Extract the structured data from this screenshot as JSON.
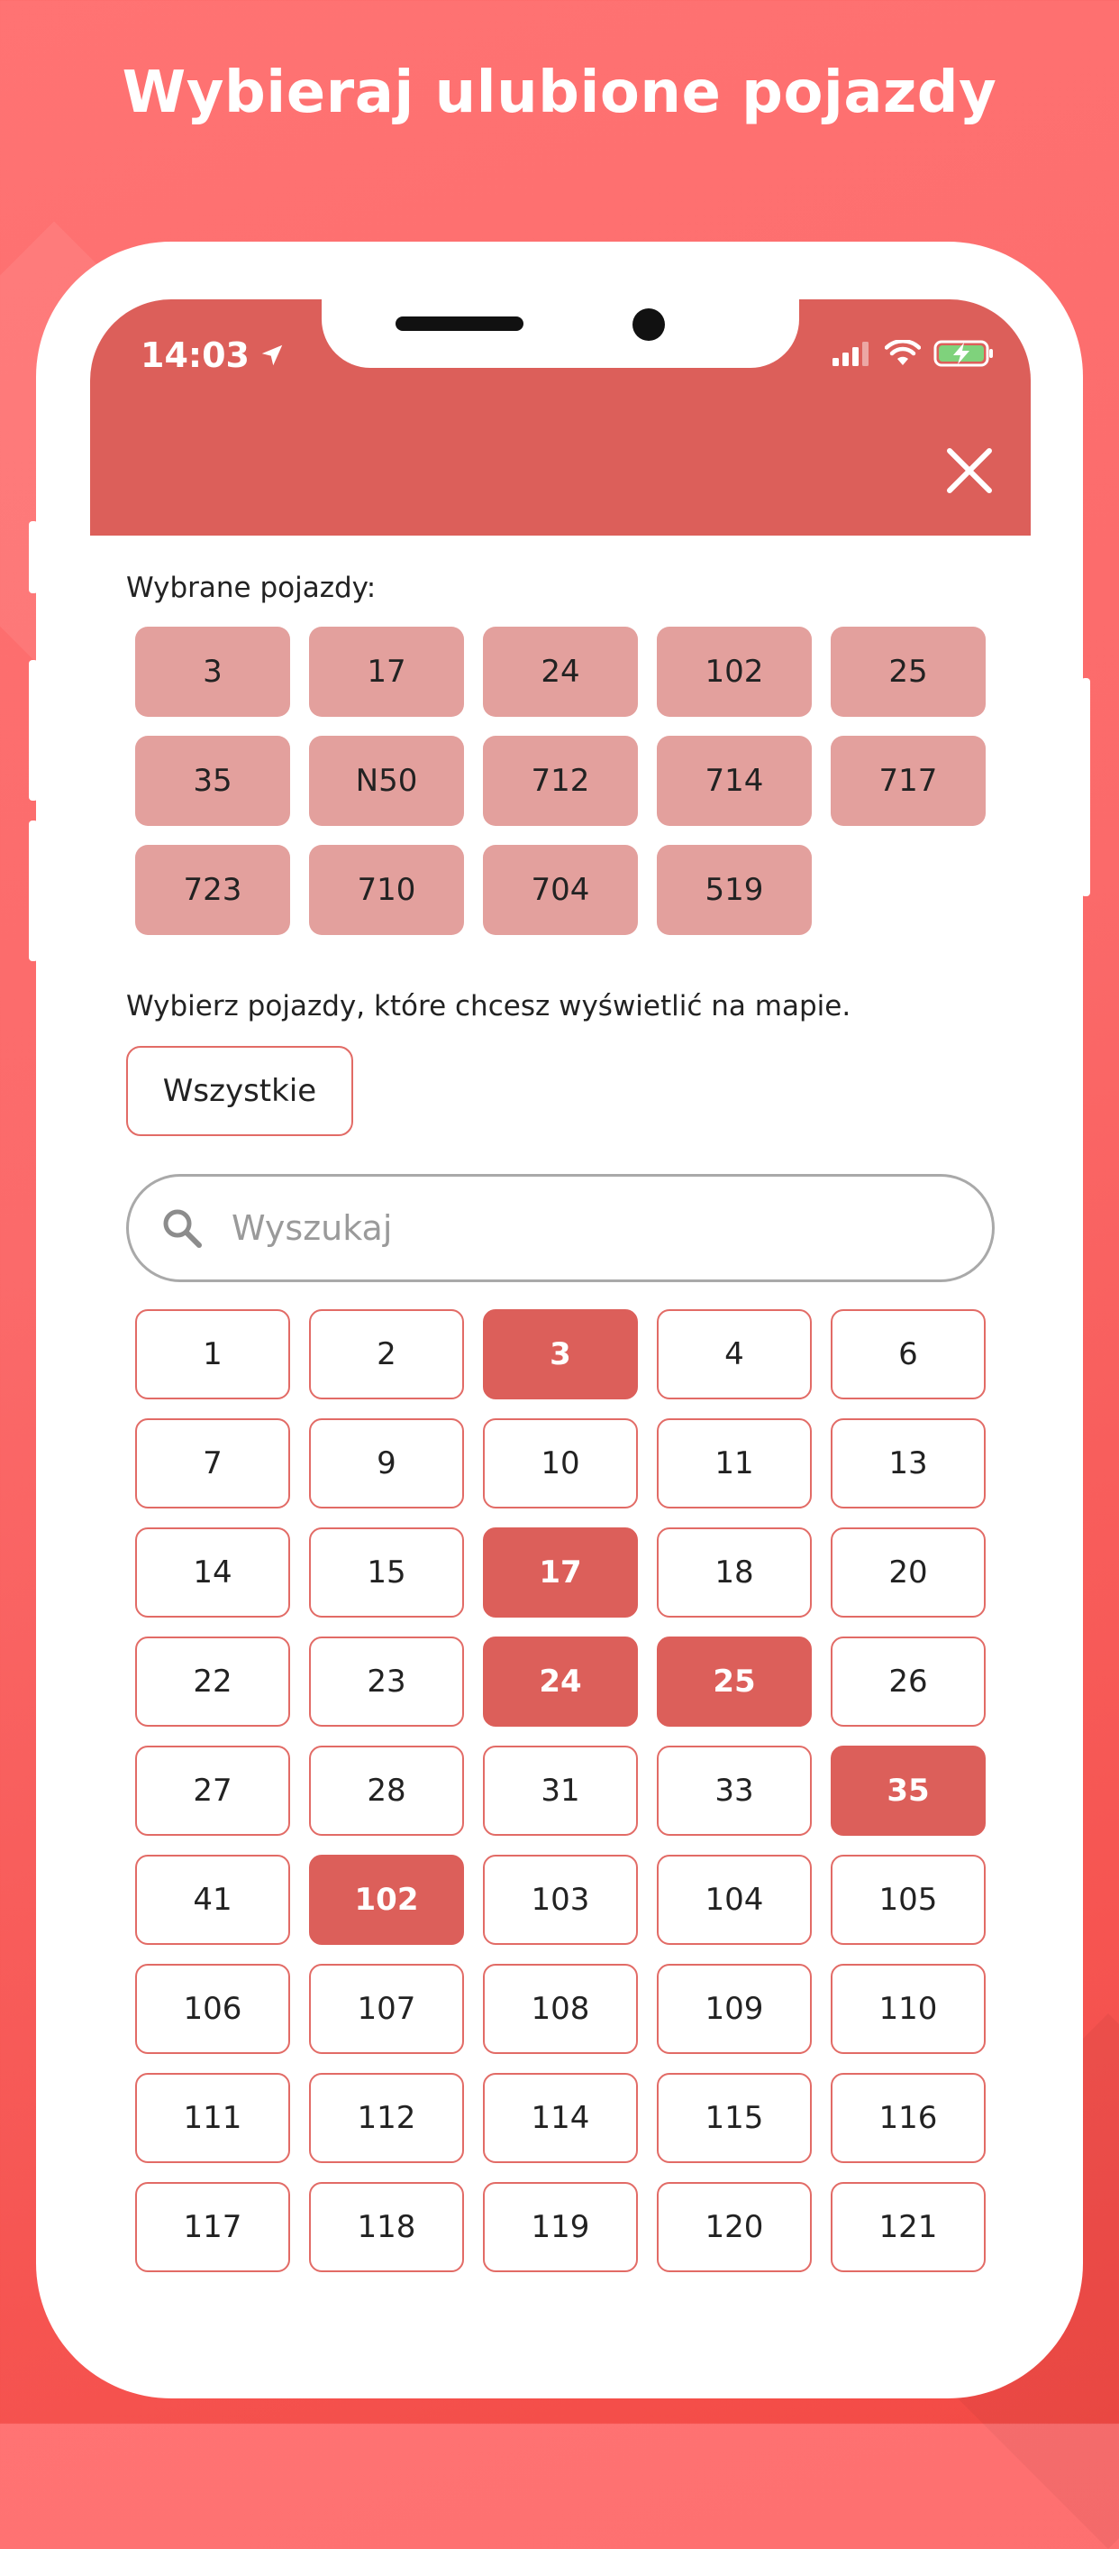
{
  "promo": {
    "title": "Wybieraj ulubione pojazdy"
  },
  "status_bar": {
    "time": "14:03",
    "icons": [
      "location-arrow-icon",
      "signal-icon",
      "wifi-icon",
      "battery-charging-icon"
    ]
  },
  "header": {
    "close_icon": "close-icon"
  },
  "selected": {
    "label": "Wybrane pojazdy:",
    "items": [
      "3",
      "17",
      "24",
      "102",
      "25",
      "35",
      "N50",
      "712",
      "714",
      "717",
      "723",
      "710",
      "704",
      "519"
    ]
  },
  "picker": {
    "instruction": "Wybierz pojazdy, które chcesz wyświetlić na mapie.",
    "all_label": "Wszystkie",
    "search_placeholder": "Wyszukaj",
    "search_value": ""
  },
  "vehicles": [
    {
      "label": "1",
      "selected": false
    },
    {
      "label": "2",
      "selected": false
    },
    {
      "label": "3",
      "selected": true
    },
    {
      "label": "4",
      "selected": false
    },
    {
      "label": "6",
      "selected": false
    },
    {
      "label": "7",
      "selected": false
    },
    {
      "label": "9",
      "selected": false
    },
    {
      "label": "10",
      "selected": false
    },
    {
      "label": "11",
      "selected": false
    },
    {
      "label": "13",
      "selected": false
    },
    {
      "label": "14",
      "selected": false
    },
    {
      "label": "15",
      "selected": false
    },
    {
      "label": "17",
      "selected": true
    },
    {
      "label": "18",
      "selected": false
    },
    {
      "label": "20",
      "selected": false
    },
    {
      "label": "22",
      "selected": false
    },
    {
      "label": "23",
      "selected": false
    },
    {
      "label": "24",
      "selected": true
    },
    {
      "label": "25",
      "selected": true
    },
    {
      "label": "26",
      "selected": false
    },
    {
      "label": "27",
      "selected": false
    },
    {
      "label": "28",
      "selected": false
    },
    {
      "label": "31",
      "selected": false
    },
    {
      "label": "33",
      "selected": false
    },
    {
      "label": "35",
      "selected": true
    },
    {
      "label": "41",
      "selected": false
    },
    {
      "label": "102",
      "selected": true
    },
    {
      "label": "103",
      "selected": false
    },
    {
      "label": "104",
      "selected": false
    },
    {
      "label": "105",
      "selected": false
    },
    {
      "label": "106",
      "selected": false
    },
    {
      "label": "107",
      "selected": false
    },
    {
      "label": "108",
      "selected": false
    },
    {
      "label": "109",
      "selected": false
    },
    {
      "label": "110",
      "selected": false
    },
    {
      "label": "111",
      "selected": false
    },
    {
      "label": "112",
      "selected": false
    },
    {
      "label": "114",
      "selected": false
    },
    {
      "label": "115",
      "selected": false
    },
    {
      "label": "116",
      "selected": false
    },
    {
      "label": "117",
      "selected": false
    },
    {
      "label": "118",
      "selected": false
    },
    {
      "label": "119",
      "selected": false
    },
    {
      "label": "120",
      "selected": false
    },
    {
      "label": "121",
      "selected": false
    }
  ],
  "colors": {
    "accent": "#dc5f5a",
    "selected_chip": "#e3a09d",
    "chip_border": "#e26b66",
    "background_start": "#ff7373",
    "background_end": "#f34a45"
  }
}
